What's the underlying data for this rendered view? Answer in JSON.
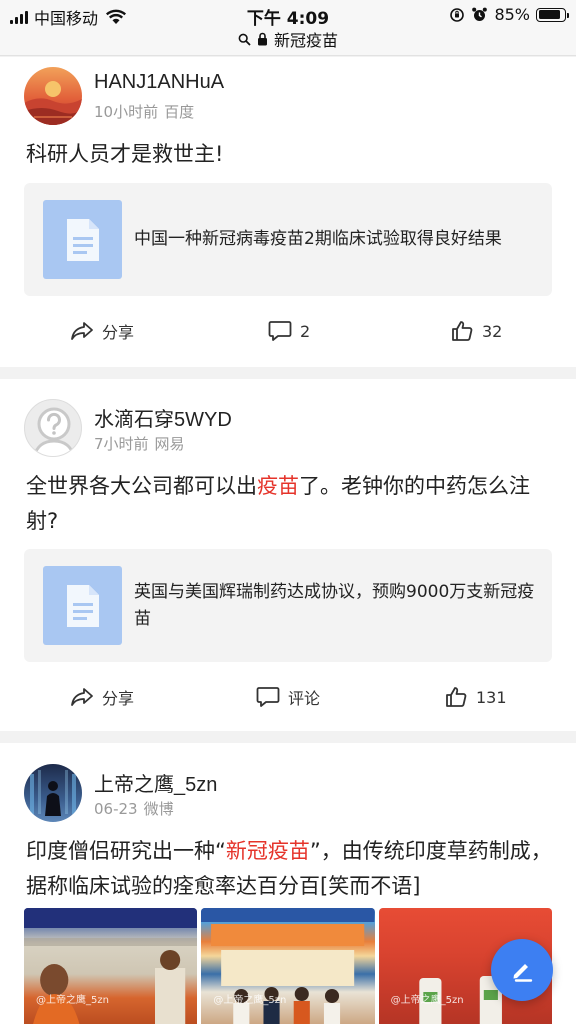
{
  "status_bar": {
    "carrier": "中国移动",
    "time": "下午 4:09",
    "battery": "85%",
    "battery_level": 0.85
  },
  "url_bar": {
    "text": "新冠疫苗"
  },
  "posts": [
    {
      "username": "HANJ1ANHuA",
      "time": "10小时前",
      "source": "百度",
      "text": "科研人员才是救世主!",
      "link_title": "中国一种新冠病毒疫苗2期临床试验取得良好结果",
      "share_label": "分享",
      "comments": "2",
      "likes": "32",
      "avatar_icon": "sunset-avatar"
    },
    {
      "username": "水滴石穿5WYD",
      "time": "7小时前",
      "source": "网易",
      "text_before": "全世界各大公司都可以出",
      "text_highlight": "疫苗",
      "text_after": "了。老钟你的中药怎么注射?",
      "link_title": "英国与美国辉瑞制药达成协议，预购9000万支新冠疫苗",
      "share_label": "分享",
      "comment_label": "评论",
      "likes": "131",
      "avatar_icon": "default-question-avatar"
    },
    {
      "username": "上帝之鹰_5zn",
      "time": "06-23",
      "source": "微博",
      "text_before": "印度僧侣研究出一种“",
      "text_highlight": "新冠疫苗",
      "text_after": "”，由传统印度草药制成，据称临床试验的痊愈率达百分百[笑而不语]",
      "photo_watermark": "@上帝之鹰_5zn",
      "avatar_icon": "figure-avatar"
    }
  ],
  "fab": {
    "icon": "edit-pen-icon"
  },
  "colors": {
    "accent": "#3d7ff2",
    "highlight": "#e5332a",
    "link_thumb": "#a9c7f2"
  }
}
